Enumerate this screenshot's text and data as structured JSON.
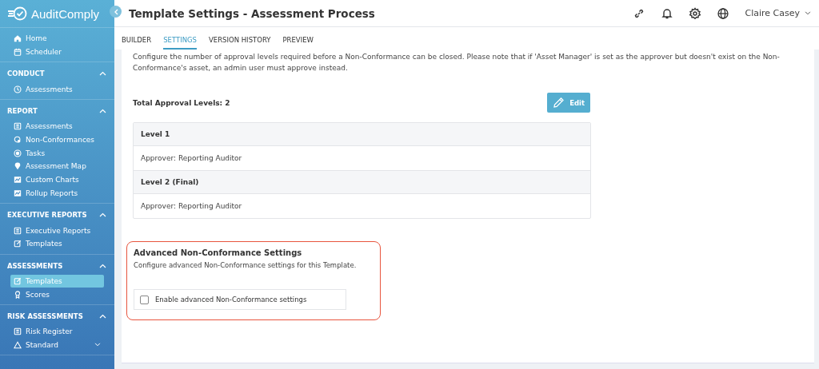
{
  "brand": "AuditComply",
  "sidebar": {
    "top_items": [
      {
        "label": "Home",
        "selected": false
      },
      {
        "label": "Scheduler",
        "selected": false
      }
    ],
    "sections": [
      {
        "title": "CONDUCT",
        "expanded": true,
        "items": [
          {
            "label": "Assessments",
            "selected": false,
            "kind": "link"
          }
        ]
      },
      {
        "title": "REPORT",
        "expanded": true,
        "items": [
          {
            "label": "Assessments",
            "selected": false,
            "kind": "link"
          },
          {
            "label": "Non-Conformances",
            "selected": false,
            "kind": "link"
          },
          {
            "label": "Tasks",
            "selected": false,
            "kind": "link"
          },
          {
            "label": "Assessment Map",
            "selected": false,
            "kind": "link"
          },
          {
            "label": "Custom Charts",
            "selected": false,
            "kind": "link"
          },
          {
            "label": "Rollup Reports",
            "selected": false,
            "kind": "link"
          }
        ]
      },
      {
        "title": "EXECUTIVE REPORTS",
        "expanded": true,
        "items": [
          {
            "label": "Executive Reports",
            "selected": false,
            "kind": "link"
          },
          {
            "label": "Templates",
            "selected": false,
            "kind": "link"
          }
        ]
      },
      {
        "title": "ASSESSMENTS",
        "expanded": true,
        "items": [
          {
            "label": "Templates",
            "selected": true,
            "kind": "link"
          },
          {
            "label": "Scores",
            "selected": false,
            "kind": "link"
          }
        ]
      },
      {
        "title": "RISK ASSESSMENTS",
        "expanded": true,
        "items": [
          {
            "label": "Risk Register",
            "selected": false,
            "kind": "link"
          },
          {
            "label": "Standard",
            "selected": false,
            "kind": "group"
          }
        ]
      }
    ]
  },
  "header": {
    "title": "Template Settings - Assessment Process",
    "user": "Claire Casey"
  },
  "tabs": [
    {
      "label": "BUILDER",
      "selected": false
    },
    {
      "label": "SETTINGS",
      "selected": true
    },
    {
      "label": "VERSION HISTORY",
      "selected": false
    },
    {
      "label": "PREVIEW",
      "selected": false
    }
  ],
  "approval": {
    "description": "Configure the number of approval levels required before a Non-Conformance can be closed. Please note that if 'Asset Manager' is set as the approver but doesn't exist on the Non-Conformance's asset, an admin user must approve instead.",
    "total": "Total Approval Levels: 2",
    "edit_button": "Edit",
    "levels": [
      {
        "title": "Level 1",
        "approver": "Approver: Reporting Auditor"
      },
      {
        "title": "Level 2 (Final)",
        "approver": "Approver: Reporting Auditor"
      }
    ]
  },
  "advanced": {
    "title": "Advanced Non-Conformance Settings",
    "description": "Configure advanced Non-Conformance settings for this Template.",
    "option": {
      "label": "Enable advanced Non-Conformance settings",
      "checked": false
    }
  }
}
